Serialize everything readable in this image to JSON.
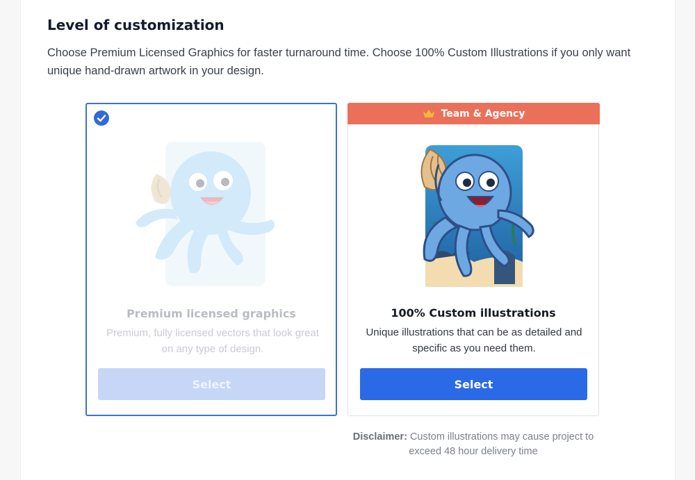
{
  "section": {
    "title": "Level of customization",
    "description": "Choose Premium Licensed Graphics for faster turnaround time. Choose 100% Custom Illustrations if you only want unique hand-drawn artwork in your design."
  },
  "options": [
    {
      "title": "Premium licensed graphics",
      "description": "Premium, fully licensed vectors that look great on any type of design.",
      "button_label": "Select",
      "selected": true
    },
    {
      "badge": "Team & Agency",
      "title": "100% Custom illustrations",
      "description": "Unique illustrations that can be as detailed and specific as you need them.",
      "button_label": "Select",
      "selected": false
    }
  ],
  "disclaimer": {
    "label": "Disclaimer:",
    "text": "Custom illustrations may cause project to exceed 48 hour delivery time"
  },
  "colors": {
    "accent": "#2b6ae6",
    "selected_border": "#3a73d6",
    "badge": "#ea705a",
    "crown": "#f6b73c"
  },
  "icons": {
    "check": "check-circle-icon",
    "crown": "crown-icon"
  }
}
